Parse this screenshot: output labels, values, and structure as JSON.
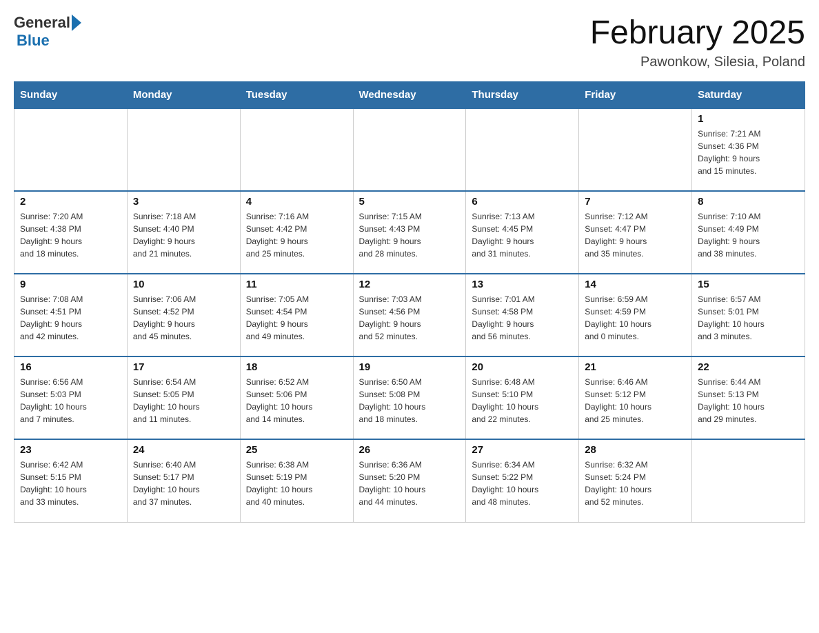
{
  "header": {
    "logo": {
      "general": "General",
      "arrow": "",
      "blue": "Blue"
    },
    "title": "February 2025",
    "subtitle": "Pawonkow, Silesia, Poland"
  },
  "weekdays": [
    "Sunday",
    "Monday",
    "Tuesday",
    "Wednesday",
    "Thursday",
    "Friday",
    "Saturday"
  ],
  "weeks": [
    [
      {
        "day": "",
        "info": ""
      },
      {
        "day": "",
        "info": ""
      },
      {
        "day": "",
        "info": ""
      },
      {
        "day": "",
        "info": ""
      },
      {
        "day": "",
        "info": ""
      },
      {
        "day": "",
        "info": ""
      },
      {
        "day": "1",
        "info": "Sunrise: 7:21 AM\nSunset: 4:36 PM\nDaylight: 9 hours\nand 15 minutes."
      }
    ],
    [
      {
        "day": "2",
        "info": "Sunrise: 7:20 AM\nSunset: 4:38 PM\nDaylight: 9 hours\nand 18 minutes."
      },
      {
        "day": "3",
        "info": "Sunrise: 7:18 AM\nSunset: 4:40 PM\nDaylight: 9 hours\nand 21 minutes."
      },
      {
        "day": "4",
        "info": "Sunrise: 7:16 AM\nSunset: 4:42 PM\nDaylight: 9 hours\nand 25 minutes."
      },
      {
        "day": "5",
        "info": "Sunrise: 7:15 AM\nSunset: 4:43 PM\nDaylight: 9 hours\nand 28 minutes."
      },
      {
        "day": "6",
        "info": "Sunrise: 7:13 AM\nSunset: 4:45 PM\nDaylight: 9 hours\nand 31 minutes."
      },
      {
        "day": "7",
        "info": "Sunrise: 7:12 AM\nSunset: 4:47 PM\nDaylight: 9 hours\nand 35 minutes."
      },
      {
        "day": "8",
        "info": "Sunrise: 7:10 AM\nSunset: 4:49 PM\nDaylight: 9 hours\nand 38 minutes."
      }
    ],
    [
      {
        "day": "9",
        "info": "Sunrise: 7:08 AM\nSunset: 4:51 PM\nDaylight: 9 hours\nand 42 minutes."
      },
      {
        "day": "10",
        "info": "Sunrise: 7:06 AM\nSunset: 4:52 PM\nDaylight: 9 hours\nand 45 minutes."
      },
      {
        "day": "11",
        "info": "Sunrise: 7:05 AM\nSunset: 4:54 PM\nDaylight: 9 hours\nand 49 minutes."
      },
      {
        "day": "12",
        "info": "Sunrise: 7:03 AM\nSunset: 4:56 PM\nDaylight: 9 hours\nand 52 minutes."
      },
      {
        "day": "13",
        "info": "Sunrise: 7:01 AM\nSunset: 4:58 PM\nDaylight: 9 hours\nand 56 minutes."
      },
      {
        "day": "14",
        "info": "Sunrise: 6:59 AM\nSunset: 4:59 PM\nDaylight: 10 hours\nand 0 minutes."
      },
      {
        "day": "15",
        "info": "Sunrise: 6:57 AM\nSunset: 5:01 PM\nDaylight: 10 hours\nand 3 minutes."
      }
    ],
    [
      {
        "day": "16",
        "info": "Sunrise: 6:56 AM\nSunset: 5:03 PM\nDaylight: 10 hours\nand 7 minutes."
      },
      {
        "day": "17",
        "info": "Sunrise: 6:54 AM\nSunset: 5:05 PM\nDaylight: 10 hours\nand 11 minutes."
      },
      {
        "day": "18",
        "info": "Sunrise: 6:52 AM\nSunset: 5:06 PM\nDaylight: 10 hours\nand 14 minutes."
      },
      {
        "day": "19",
        "info": "Sunrise: 6:50 AM\nSunset: 5:08 PM\nDaylight: 10 hours\nand 18 minutes."
      },
      {
        "day": "20",
        "info": "Sunrise: 6:48 AM\nSunset: 5:10 PM\nDaylight: 10 hours\nand 22 minutes."
      },
      {
        "day": "21",
        "info": "Sunrise: 6:46 AM\nSunset: 5:12 PM\nDaylight: 10 hours\nand 25 minutes."
      },
      {
        "day": "22",
        "info": "Sunrise: 6:44 AM\nSunset: 5:13 PM\nDaylight: 10 hours\nand 29 minutes."
      }
    ],
    [
      {
        "day": "23",
        "info": "Sunrise: 6:42 AM\nSunset: 5:15 PM\nDaylight: 10 hours\nand 33 minutes."
      },
      {
        "day": "24",
        "info": "Sunrise: 6:40 AM\nSunset: 5:17 PM\nDaylight: 10 hours\nand 37 minutes."
      },
      {
        "day": "25",
        "info": "Sunrise: 6:38 AM\nSunset: 5:19 PM\nDaylight: 10 hours\nand 40 minutes."
      },
      {
        "day": "26",
        "info": "Sunrise: 6:36 AM\nSunset: 5:20 PM\nDaylight: 10 hours\nand 44 minutes."
      },
      {
        "day": "27",
        "info": "Sunrise: 6:34 AM\nSunset: 5:22 PM\nDaylight: 10 hours\nand 48 minutes."
      },
      {
        "day": "28",
        "info": "Sunrise: 6:32 AM\nSunset: 5:24 PM\nDaylight: 10 hours\nand 52 minutes."
      },
      {
        "day": "",
        "info": ""
      }
    ]
  ]
}
